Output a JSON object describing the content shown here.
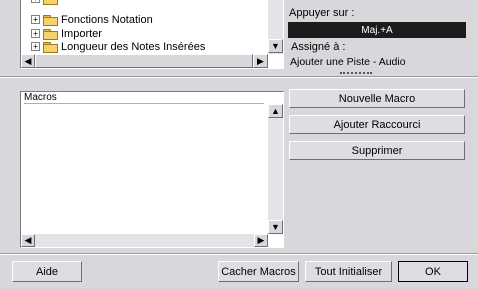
{
  "tree": {
    "items": [
      {
        "label": "Fonctions Notation"
      },
      {
        "label": "Importer"
      },
      {
        "label": "Longueur des Notes Insérées"
      }
    ],
    "expand_glyph": "+"
  },
  "shortcut": {
    "press_label": "Appuyer sur :",
    "key_value": "Maj.+A",
    "assigned_label": "Assigné à :",
    "assigned_value": "Ajouter une Piste - Audio"
  },
  "macros": {
    "header": "Macros",
    "buttons": {
      "new": "Nouvelle Macro",
      "add_shortcut": "Ajouter Raccourci",
      "delete": "Supprimer"
    }
  },
  "footer": {
    "help": "Aide",
    "hide_macros": "Cacher Macros",
    "reset_all": "Tout Initialiser",
    "ok": "OK"
  },
  "scroll_glyphs": {
    "up": "▲",
    "down": "▼",
    "left": "◀",
    "right": "▶"
  },
  "colors": {
    "background": "#d8d7dc",
    "key_field_bg": "#1c1c1c",
    "key_field_fg": "#ffffff"
  }
}
